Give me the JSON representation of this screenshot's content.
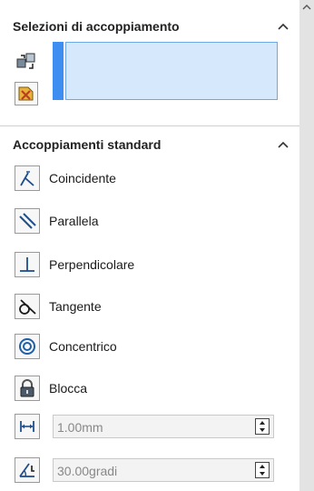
{
  "mate_selections": {
    "title": "Selezioni di accoppiamento",
    "collapse_icon": "chevron-up-icon",
    "icons": [
      "selection-component-icon",
      "selection-filter-icon"
    ],
    "selection_box_value": "",
    "accent_color": "#3e8ef2"
  },
  "standard_mates": {
    "title": "Accoppiamenti standard",
    "collapse_icon": "chevron-up-icon",
    "items": [
      {
        "label": "Coincidente",
        "icon": "coincident-icon"
      },
      {
        "label": "Parallela",
        "icon": "parallel-icon"
      },
      {
        "label": "Perpendicolare",
        "icon": "perpendicular-icon"
      },
      {
        "label": "Tangente",
        "icon": "tangent-icon"
      },
      {
        "label": "Concentrico",
        "icon": "concentric-icon"
      },
      {
        "label": "Blocca",
        "icon": "lock-icon"
      }
    ],
    "distance": {
      "value": "1.00mm",
      "icon": "distance-icon"
    },
    "angle": {
      "value": "30.00gradi",
      "icon": "angle-icon"
    }
  }
}
